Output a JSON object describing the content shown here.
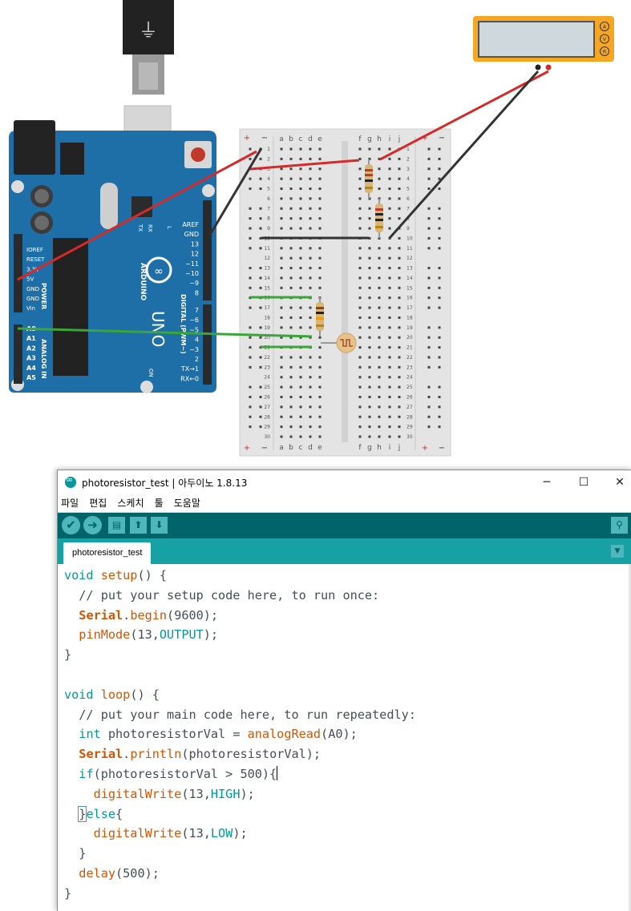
{
  "window": {
    "title": "photoresistor_test | 아두이노 1.8.13",
    "minimize": "─",
    "maximize": "☐",
    "close": "✕"
  },
  "menu": [
    "파일",
    "편집",
    "스케치",
    "툴",
    "도움말"
  ],
  "toolbar": {
    "verify_icon": "check-icon",
    "upload_icon": "arrow-right-icon",
    "new_icon": "new-file-icon",
    "open_icon": "open-icon",
    "save_icon": "save-icon",
    "serial_icon": "magnifier-icon"
  },
  "tab": {
    "label": "photoresistor_test"
  },
  "code": {
    "l1_kw": "void",
    "l1_fn": "setup",
    "l1_rest": "() {",
    "l2": "  // put your setup code here, to run once:",
    "l3_obj": "Serial",
    "l3_dot": ".",
    "l3_fn": "begin",
    "l3_rest": "(9600);",
    "l4_fn": "pinMode",
    "l4_mid": "(13,",
    "l4_kw": "OUTPUT",
    "l4_end": ");",
    "l5": "}",
    "l7_kw": "void",
    "l7_fn": "loop",
    "l7_rest": "() {",
    "l8": "  // put your main code here, to run repeatedly:",
    "l9_kw": "int",
    "l9_mid": " photoresistorVal = ",
    "l9_fn": "analogRead",
    "l9_end": "(A0);",
    "l10_obj": "Serial",
    "l10_dot": ".",
    "l10_fn": "println",
    "l10_end": "(photoresistorVal);",
    "l11_kw": "if",
    "l11_rest": "(photoresistorVal > 500){",
    "l12_fn": "digitalWrite",
    "l12_mid": "(13,",
    "l12_kw": "HIGH",
    "l12_end": ");",
    "l13_b": "}",
    "l13_kw": "else",
    "l13_end": "{",
    "l14_fn": "digitalWrite",
    "l14_mid": "(13,",
    "l14_kw": "LOW",
    "l14_end": ");",
    "l15": "  }",
    "l16_fn": "delay",
    "l16_end": "(500);",
    "l17": "}"
  },
  "circuit": {
    "arduino": {
      "brand": "ARDUINO",
      "model": "UNO",
      "digital_header": "DIGITAL (PWM~)",
      "power_header": "POWER",
      "analog_header": "ANALOG IN",
      "power_pins": [
        "IOREF",
        "RESET",
        "3.3V",
        "5V",
        "GND",
        "GND",
        "Vin"
      ],
      "analog_pins": [
        "A0",
        "A1",
        "A2",
        "A3",
        "A4",
        "A5"
      ],
      "digital_pins": [
        "AREF",
        "GND",
        "13",
        "12",
        "~11",
        "~10",
        "~9",
        "8",
        "7",
        "~6",
        "~5",
        "4",
        "~3",
        "2",
        "TX→1",
        "RX←0"
      ],
      "tx_label": "TX",
      "rx_label": "RX",
      "l_label": "L",
      "on_label": "ON"
    },
    "breadboard": {
      "cols_left": [
        "a",
        "b",
        "c",
        "d",
        "e"
      ],
      "cols_right": [
        "f",
        "g",
        "h",
        "i",
        "j"
      ],
      "rows": 30,
      "plus": "+",
      "minus": "−"
    },
    "multimeter": {
      "dial": [
        "A",
        "V",
        "R"
      ]
    },
    "colors": {
      "board": "#1e6fa8",
      "wire_red": "#d42a2a",
      "wire_black": "#333333",
      "wire_green": "#3aa63a",
      "accent": "#00979c"
    }
  }
}
